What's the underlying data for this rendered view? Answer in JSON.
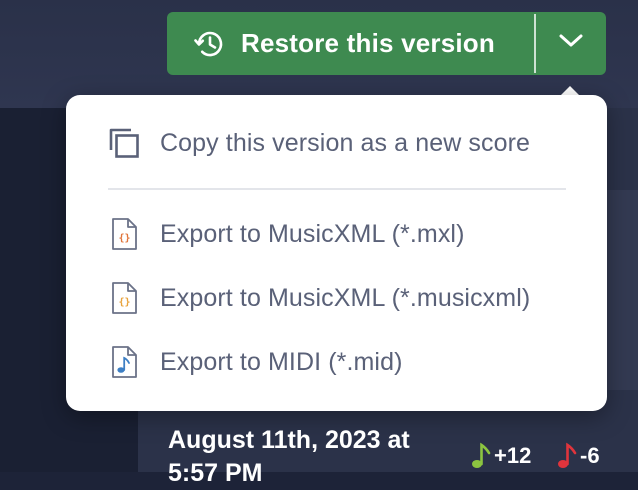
{
  "colors": {
    "primary_green": "#3e8a50",
    "menu_text": "#5a6178",
    "added": "#8cc540",
    "removed": "#e0343c"
  },
  "restore": {
    "label": "Restore this version",
    "icon": "history-icon",
    "caret_icon": "chevron-down-icon"
  },
  "menu": {
    "items": [
      {
        "label": "Copy this version as a new score",
        "icon": "copy-icon"
      },
      {
        "label": "Export to MusicXML (*.mxl)",
        "icon": "xml-file-icon"
      },
      {
        "label": "Export to MusicXML (*.musicxml)",
        "icon": "xml-file-icon"
      },
      {
        "label": "Export to MIDI (*.mid)",
        "icon": "midi-file-icon"
      }
    ]
  },
  "version": {
    "date_line1": "August 11th, 2023 at",
    "date_line2": "5:57 PM",
    "added": "+12",
    "removed": "-6"
  }
}
